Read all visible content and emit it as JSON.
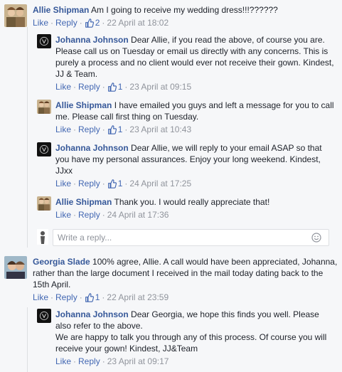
{
  "comments": [
    {
      "author": "Allie Shipman",
      "text": "Am I going to receive my wedding dress!!!??????",
      "actions": {
        "like": "Like",
        "reply": "Reply",
        "likes": "2",
        "time": "22 April at 18:02"
      }
    },
    {
      "author": "Johanna Johnson",
      "text": "Dear Allie, if you read the above, of course you are. Please call us on Tuesday or email us directly with any concerns. This is purely a process and no client would ever not receive their gown. Kindest, JJ & Team.",
      "actions": {
        "like": "Like",
        "reply": "Reply",
        "likes": "1",
        "time": "23 April at 09:15"
      }
    },
    {
      "author": "Allie Shipman",
      "text": "I have emailed you guys and left a message for you to call me. Please call first thing on Tuesday.",
      "actions": {
        "like": "Like",
        "reply": "Reply",
        "likes": "1",
        "time": "23 April at 10:43"
      }
    },
    {
      "author": "Johanna Johnson",
      "text": "Dear Allie, we will reply to your email ASAP so that you have my personal assurances. Enjoy your long weekend. Kindest, JJxx",
      "actions": {
        "like": "Like",
        "reply": "Reply",
        "likes": "1",
        "time": "24 April at 17:25"
      }
    },
    {
      "author": "Allie Shipman",
      "text": "Thank you. I would really appreciate that!",
      "actions": {
        "like": "Like",
        "reply": "Reply",
        "time": "24 April at 17:36"
      }
    },
    {
      "author": "Georgia Slade",
      "text": "100% agree, Allie. A call would have been appreciated, Johanna, rather than the large document I received in the mail today dating back to the 15th April.",
      "actions": {
        "like": "Like",
        "reply": "Reply",
        "likes": "1",
        "time": "22 April at 23:59"
      }
    },
    {
      "author": "Johanna Johnson",
      "text": "Dear Georgia, we hope this finds you well. Please also refer to the above.",
      "text2": "We are happy to talk you through any of this process. Of course you will receive your gown! Kindest, JJ&Team",
      "actions": {
        "like": "Like",
        "reply": "Reply",
        "time": "23 April at 09:17"
      }
    }
  ],
  "reply_box": {
    "placeholder": "Write a reply..."
  },
  "colors": {
    "author": "#365899",
    "link": "#4267b2",
    "meta": "#90949c",
    "background": "#f6f7f9"
  },
  "icons": {
    "like_count": "thumbs-up-icon",
    "emoji": "smiley-icon"
  }
}
